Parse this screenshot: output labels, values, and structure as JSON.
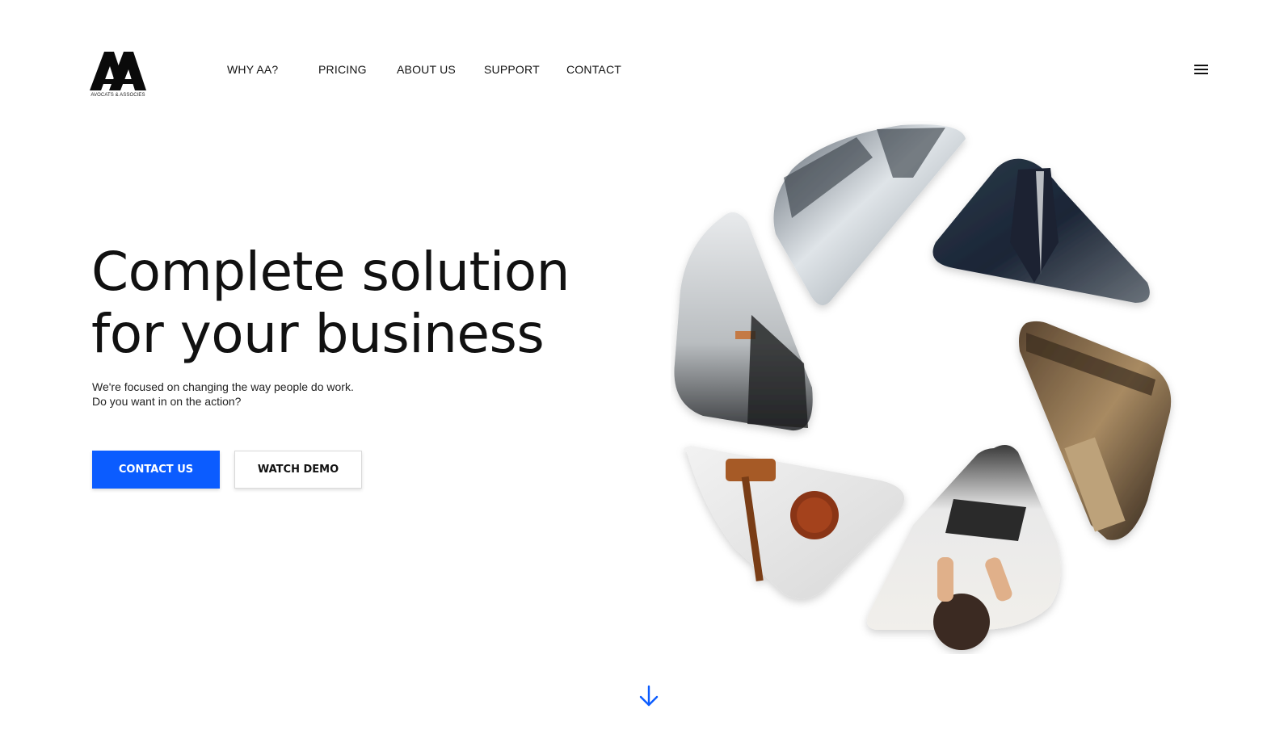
{
  "header": {
    "logo_text": "AVOCATS & ASSOCIES",
    "nav": [
      "WHY AA?",
      "PRICING",
      "ABOUT US",
      "SUPPORT",
      "CONTACT"
    ],
    "menu_icon": "hamburger-menu-icon"
  },
  "hero": {
    "title_line1": "Complete solution",
    "title_line2": "for your business",
    "subtitle_line1": "We're focused on changing the way people do work.",
    "subtitle_line2": "Do you want in on the action?",
    "primary_button": "CONTACT US",
    "secondary_button": "WATCH DEMO"
  },
  "scroll_icon": "arrow-down-icon",
  "colors": {
    "accent": "#0b5cff",
    "text": "#111111",
    "background": "#ffffff"
  }
}
